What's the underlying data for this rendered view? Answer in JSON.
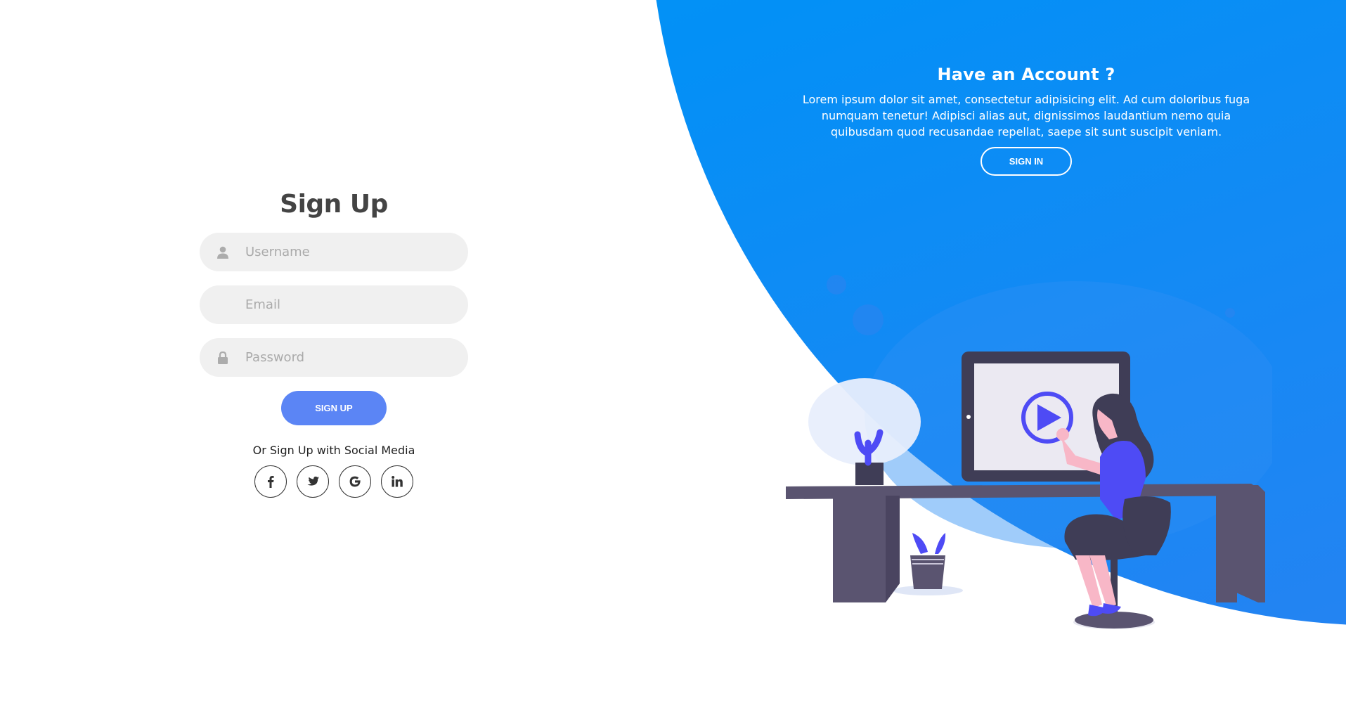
{
  "signup_form": {
    "title": "Sign Up",
    "username_placeholder": "Username",
    "email_placeholder": "Email",
    "password_placeholder": "Password",
    "submit_label": "SIGN UP",
    "social_text": "Or Sign Up with Social Media",
    "social_icons": [
      "facebook-icon",
      "twitter-icon",
      "google-icon",
      "linkedin-icon"
    ]
  },
  "right_panel": {
    "heading": "Have an Account ?",
    "description": "Lorem ipsum dolor sit amet, consectetur adipisicing elit. Ad cum doloribus fuga numquam tenetur! Adipisci alias aut, dignissimos laudantium nemo quia quibusdam quod recusandae repellat, saepe sit sunt suscipit veniam.",
    "button_label": "SIGN IN"
  },
  "colors": {
    "accent": "#5b85f5",
    "panel_gradient_start": "#03a4f9",
    "panel_gradient_end": "#2f7ff1",
    "input_bg": "#f0f0f0",
    "title_text": "#444444"
  }
}
